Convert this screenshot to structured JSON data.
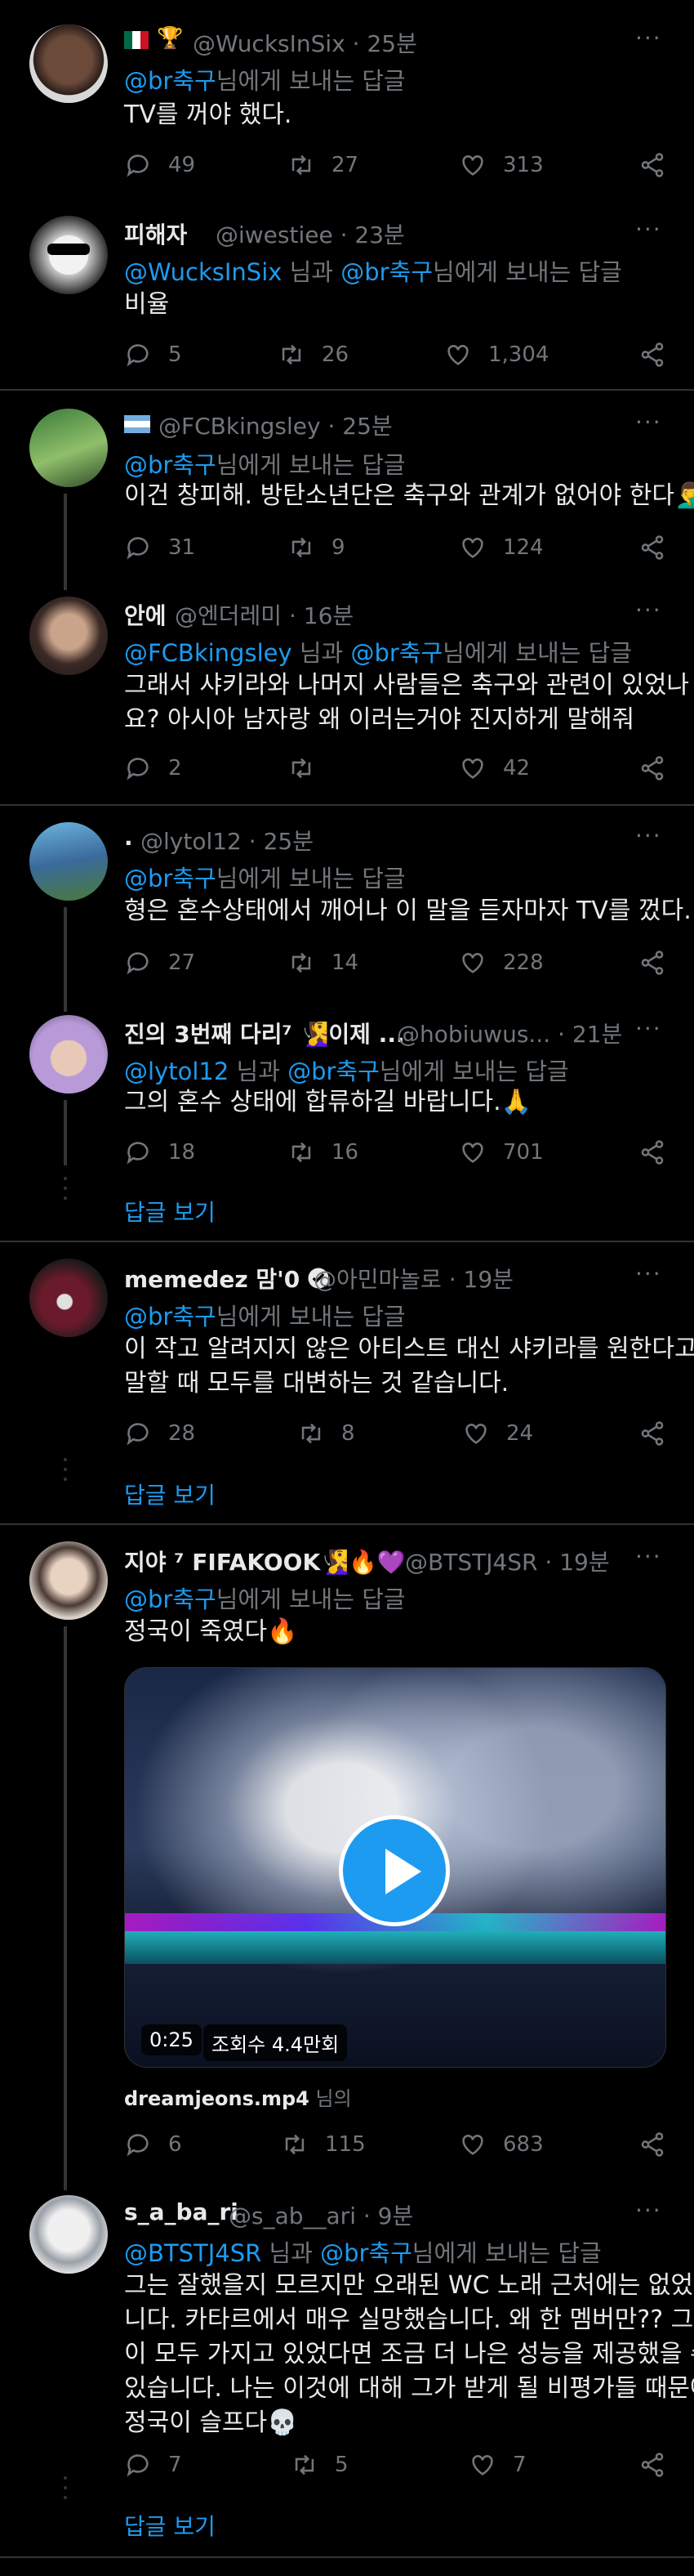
{
  "ui": {
    "reply_to": "님에게 보내는 답글",
    "and": " 님과 ",
    "show_replies": "답글 보기",
    "sep": " · "
  },
  "tweets": [
    {
      "name": "",
      "handle": "@WucksInSix",
      "time": "25분",
      "reply_to": [
        "@br축구"
      ],
      "lines": [
        "TV를 꺼야 했다."
      ],
      "replies": "49",
      "retweets": "27",
      "likes": "313"
    },
    {
      "name": "피해자",
      "handle": "@iwestiee",
      "time": "23분",
      "reply_to": [
        "@WucksInSix",
        "@br축구"
      ],
      "lines": [
        "비율"
      ],
      "replies": "5",
      "retweets": "26",
      "likes": "1,304"
    },
    {
      "name": "",
      "handle": "@FCBkingsley",
      "time": "25분",
      "reply_to": [
        "@br축구"
      ],
      "lines": [
        "이건 창피해. 방탄소년단은 축구와 관계가 없어야 한다🤦‍♂️"
      ],
      "replies": "31",
      "retweets": "9",
      "likes": "124"
    },
    {
      "name": "안에",
      "handle": "@엔더레미",
      "time": "16분",
      "reply_to": [
        "@FCBkingsley",
        "@br축구"
      ],
      "lines": [
        "그래서 샤키라와 나머지 사람들은 축구와 관련이 있었나",
        "요? 아시아 남자랑 왜 이러는거야 진지하게 말해줘"
      ],
      "replies": "2",
      "retweets": "",
      "likes": "42"
    },
    {
      "name": ".",
      "handle": "@lytol12",
      "time": "25분",
      "reply_to": [
        "@br축구"
      ],
      "lines": [
        "형은 혼수상태에서 깨어나 이 말을 듣자마자 TV를 껐다."
      ],
      "replies": "27",
      "retweets": "14",
      "likes": "228"
    },
    {
      "name": "진의 3번째 다리⁷ 🧏‍♀️이제 ...",
      "handle": "@hobiuwus...",
      "time": "21분",
      "reply_to": [
        "@lytol12",
        "@br축구"
      ],
      "lines": [
        "그의 혼수 상태에 합류하길 바랍니다.🙏"
      ],
      "replies": "18",
      "retweets": "16",
      "likes": "701"
    },
    {
      "name": "memedez 맘'0",
      "handle": "@아민마놀로",
      "time": "19분",
      "reply_to": [
        "@br축구"
      ],
      "lines": [
        "이 작고 알려지지 않은 아티스트 대신 샤키라를 원한다고",
        "말할 때 모두를 대변하는 것 같습니다."
      ],
      "replies": "28",
      "retweets": "8",
      "likes": "24"
    },
    {
      "name": "지야 ⁷ FIFAKOOK🧏‍♀️🔥💜",
      "handle": "@BTSTJ4SR",
      "time": "19분",
      "reply_to": [
        "@br축구"
      ],
      "lines": [
        "정국이 죽였다🔥"
      ],
      "replies": "6",
      "retweets": "115",
      "likes": "683"
    },
    {
      "name": "s_a_ba_ri",
      "handle": "@s_ab__ari",
      "time": "9분",
      "reply_to": [
        "@BTSTJ4SR",
        "@br축구"
      ],
      "lines": [
        "그는 잘했을지 모르지만 오래된 WC 노래 근처에는 없었습",
        "니다. 카타르에서 매우 실망했습니다. 왜 한 멤버만?? 그들",
        "이 모두 가지고 있었다면 조금 더 나은 성능을 제공했을 수",
        "있습니다. 나는 이것에 대해 그가 받게 될 비평가들 때문에",
        "정국이 슬프다💀"
      ],
      "replies": "7",
      "retweets": "5",
      "likes": "7"
    }
  ],
  "video": {
    "duration": "0:25",
    "views": "조회수 4.4만회",
    "file": "dreamjeons.mp4",
    "suffix": " 님의"
  },
  "icons": {
    "reply": "reply-icon",
    "retweet": "retweet-icon",
    "like": "heart-icon",
    "share": "share-icon",
    "more": "more-icon",
    "verified": "verified-icon",
    "play": "play-icon"
  },
  "colors": {
    "background": "#000000",
    "text": "#e7e9ea",
    "muted": "#71767b",
    "link": "#1d9bf0",
    "divider": "#2f3336"
  }
}
